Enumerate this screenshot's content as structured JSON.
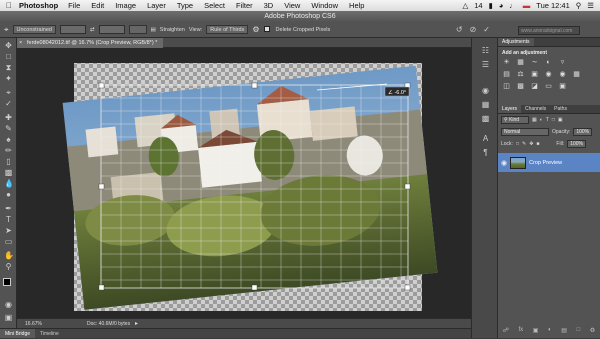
{
  "menubar": {
    "apple": "",
    "app_name": "Photoshop",
    "items": [
      "File",
      "Edit",
      "Image",
      "Layer",
      "Type",
      "Select",
      "Filter",
      "3D",
      "View",
      "Window",
      "Help"
    ],
    "status_count": "14",
    "clock": "Tue 12:41"
  },
  "window": {
    "title": "Adobe Photoshop CS6"
  },
  "options": {
    "ratio_value": "Unconstrained",
    "straighten_label": "Straighten",
    "view_label": "View:",
    "view_value": "Rule of Thirds",
    "delete_cropped_label": "Delete Cropped Pixels",
    "workspace_search": "www.anoradsignal.com"
  },
  "document": {
    "tab_title": "ferde08042012.tif @ 16.7% (Crop Preview, RGB/8*) *",
    "zoom": "16.67%",
    "doc_size": "Doc: 40.6M/0 bytes",
    "straighten_readout": "∠ -6.0°"
  },
  "bottom_tabs": [
    "Mini Bridge",
    "Timeline"
  ],
  "panels": {
    "top_tab": "Adjustments",
    "add_adjustment": "Add an adjustment",
    "adjust_icons": [
      "sun-icon",
      "curves-icon",
      "exposure-icon",
      "triangle-icon",
      "vibrance-icon",
      "grid-icon",
      "balance-icon",
      "square-icon",
      "camera-icon",
      "circle-icon",
      "table-icon",
      "diamond-icon",
      "invert-icon",
      "threshold-icon",
      "gradient-map-icon",
      "selective-icon",
      "stair-icon",
      "square-icon"
    ],
    "layer_tabs": [
      "Layers",
      "Channels",
      "Paths"
    ],
    "kind_label": "Kind",
    "blend_mode": "Normal",
    "opacity_label": "Opacity:",
    "opacity_value": "100%",
    "lock_label": "Lock:",
    "fill_label": "Fill:",
    "fill_value": "100%",
    "layer_name": "Crop Preview"
  },
  "colors": {
    "layer_selected": "#5b84c5",
    "canvas_bg": "#282828",
    "panel_bg": "#535353"
  }
}
